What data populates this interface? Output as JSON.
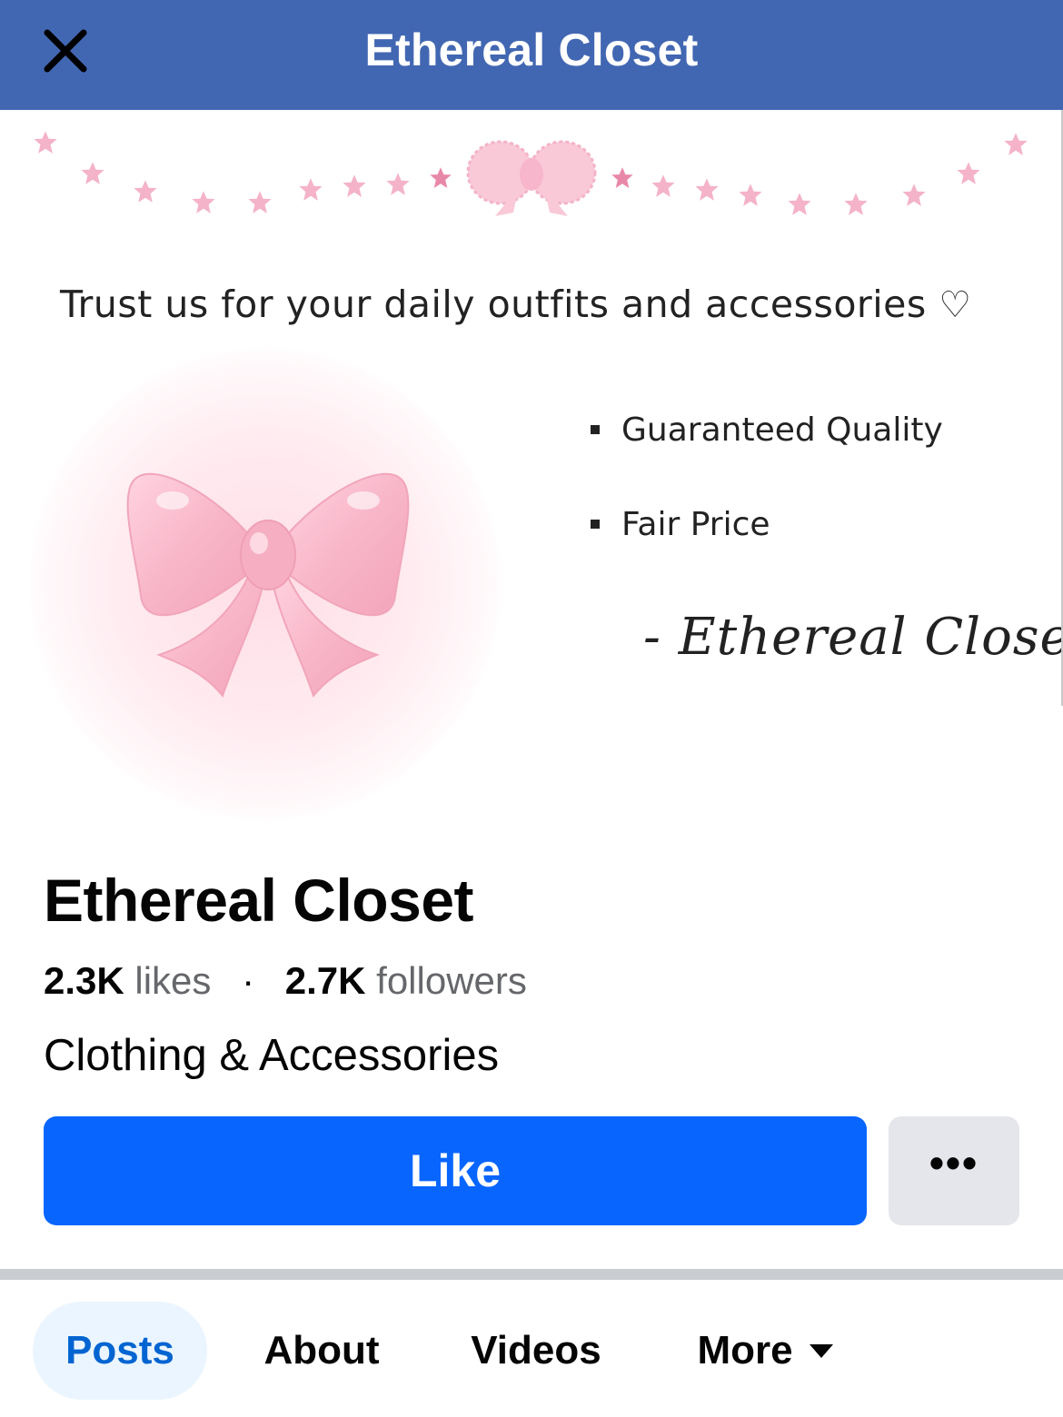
{
  "header": {
    "title": "Ethereal Closet",
    "close_icon": "close-icon",
    "background_color": "#4267b2"
  },
  "cover": {
    "tagline": "Trust us for your daily outfits and accessories",
    "tagline_heart": "♡",
    "bullets": [
      "Guaranteed Quality",
      "Fair Price"
    ],
    "signature": "- Ethereal Closet -",
    "accent_color": "#f7b6cc"
  },
  "profile": {
    "name": "Ethereal Closet",
    "likes_count": "2.3K",
    "likes_label": "likes",
    "separator": "·",
    "followers_count": "2.7K",
    "followers_label": "followers",
    "category": "Clothing & Accessories"
  },
  "actions": {
    "like_label": "Like",
    "like_color": "#0866ff",
    "more_label": "•••"
  },
  "tabs": [
    {
      "label": "Posts",
      "active": true
    },
    {
      "label": "About",
      "active": false
    },
    {
      "label": "Videos",
      "active": false
    },
    {
      "label": "More",
      "active": false
    }
  ]
}
